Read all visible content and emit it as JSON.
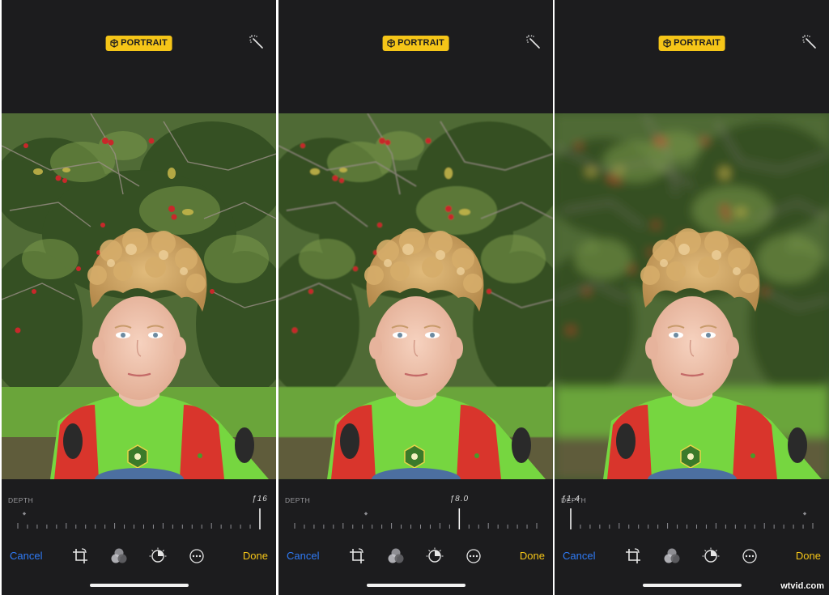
{
  "panels": [
    {
      "badge": "PORTRAIT",
      "depth_label": "DEPTH",
      "aperture": "ƒ16",
      "aperture_position": 1.0,
      "cancel": "Cancel",
      "done": "Done",
      "blur": 0
    },
    {
      "badge": "PORTRAIT",
      "depth_label": "DEPTH",
      "aperture": "ƒ8.0",
      "aperture_position": 0.68,
      "cancel": "Cancel",
      "done": "Done",
      "blur": 0.8
    },
    {
      "badge": "PORTRAIT",
      "depth_label": "DEPTH",
      "aperture": "ƒ1.4",
      "aperture_position": 0.0,
      "cancel": "Cancel",
      "done": "Done",
      "blur": 6
    }
  ],
  "icons": [
    "cube-icon",
    "magic-wand-icon",
    "crop-rotate-icon",
    "filters-icon",
    "adjust-dial-icon",
    "more-icon"
  ],
  "colors": {
    "badge": "#f5c518",
    "cancel": "#2f7bf6",
    "done": "#f5c518",
    "background": "#1c1c1e"
  },
  "watermark": "wtvid.com"
}
